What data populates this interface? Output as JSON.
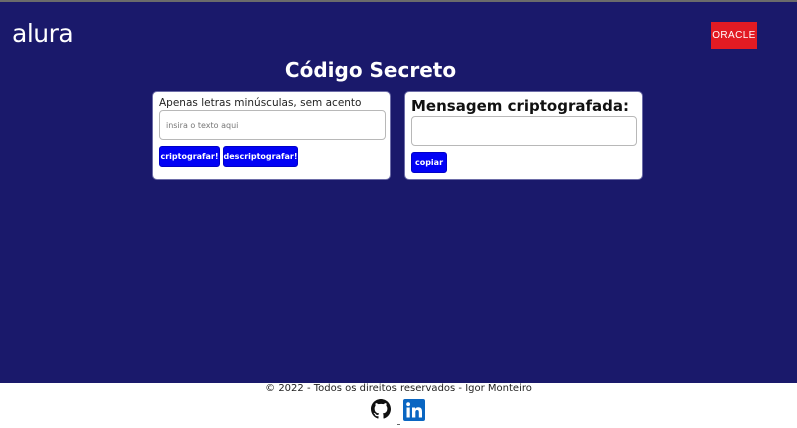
{
  "header": {
    "brand_left": "alura",
    "brand_right": "ORACLE"
  },
  "main": {
    "title": "Código Secreto"
  },
  "encrypt_card": {
    "hint": "Apenas letras minúsculas, sem acento",
    "input_placeholder": "insira o texto aqui",
    "input_value": "",
    "encrypt_label": "criptografar!",
    "decrypt_label": "descriptografar!"
  },
  "result_card": {
    "title": "Mensagem criptografada:",
    "output_value": "",
    "copy_label": "copiar"
  },
  "footer": {
    "copyright": "© 2022 - Todos os direitos reservados - Igor Monteiro",
    "icons": [
      "github-icon",
      "linkedin-icon"
    ]
  },
  "colors": {
    "background": "#1a196b",
    "button": "#0202f5",
    "oracle_red": "#e21b23",
    "linkedin_blue": "#0a66c2"
  }
}
